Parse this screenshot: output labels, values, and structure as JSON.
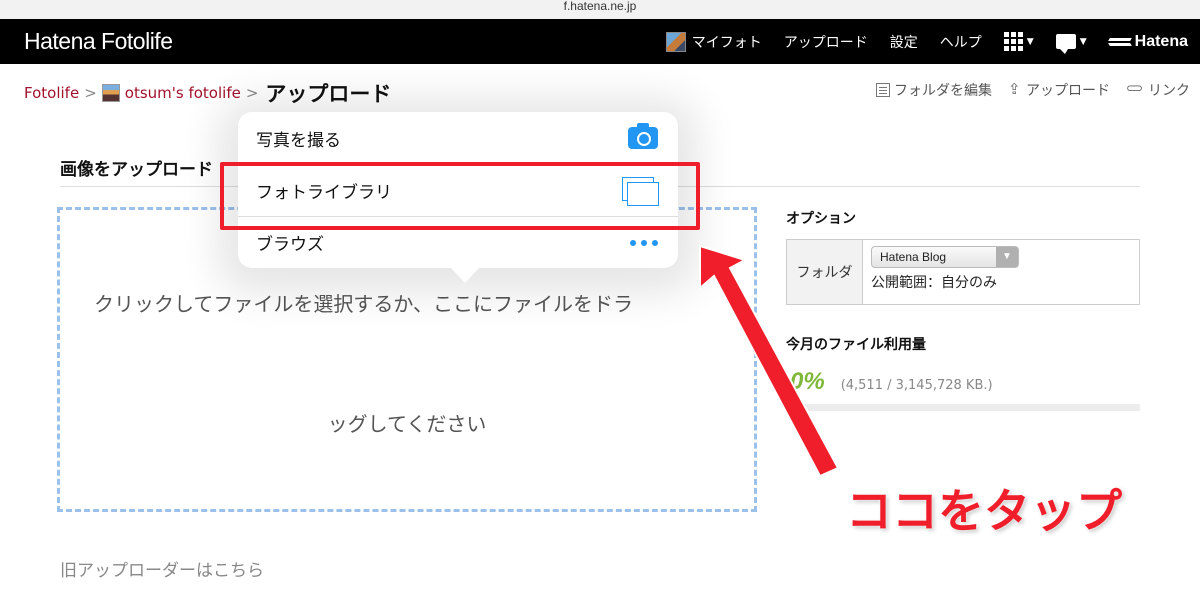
{
  "browser": {
    "url": "f.hatena.ne.jp"
  },
  "header": {
    "logo": "Hatena Fotolife",
    "nav": {
      "my_foto": "マイフォト",
      "upload": "アップロード",
      "settings": "設定",
      "help": "ヘルプ",
      "brand": "Hatena"
    }
  },
  "breadcrumb": {
    "root": "Fotolife",
    "separator": ">",
    "owner": "otsum's fotolife",
    "current": "アップロード"
  },
  "toolbar": {
    "edit_folder": "フォルダを編集",
    "upload": "アップロード",
    "link": "リンク"
  },
  "upload_section": {
    "title": "画像をアップロード",
    "drop_text_line1": "クリックしてファイルを選択するか、ここにファイルをドラ",
    "drop_text_line2": "ッグしてください",
    "old_uploader": "旧アップローダーはこちら"
  },
  "popover": {
    "items": [
      {
        "label": "写真を撮る",
        "icon": "camera-icon"
      },
      {
        "label": "フォトライブラリ",
        "icon": "photo-library-icon"
      },
      {
        "label": "ブラウズ",
        "icon": "more-icon"
      }
    ]
  },
  "options": {
    "title": "オプション",
    "folder_label": "フォルダ",
    "folder_value": "Hatena Blog",
    "visibility": "公開範囲：自分のみ"
  },
  "usage": {
    "title": "今月のファイル利用量",
    "percent_text": "0%",
    "percent_value": 0,
    "detail": "(4,511 / 3,145,728 KB.)"
  },
  "annotation": {
    "label": "ココをタップ",
    "color": "#f01e2a"
  },
  "colors": {
    "link": "#a3122c",
    "accent_blue": "#2196f3",
    "usage_green": "#7fb838"
  }
}
